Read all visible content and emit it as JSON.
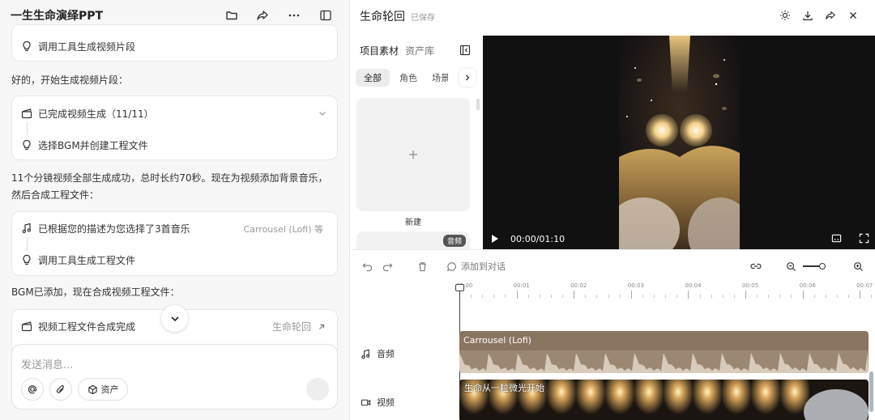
{
  "left": {
    "title": "一生生命演绎PPT",
    "step_tool_clip": "调用工具生成视频片段",
    "msg_start": "好的，开始生成视频片段：",
    "step_done": "已完成视频生成（11/11）",
    "step_bgm": "选择BGM并创建工程文件",
    "msg_summary_1": "11个分镜视频全部生成成功，总时长约70秒。现在为视频添加背景音乐，",
    "msg_summary_2": "然后合成工程文件：",
    "step_music": "已根据您的描述为您选择了3首音乐",
    "music_hint": "Carrousel (Lofi) 等",
    "step_tool_project": "调用工具生成工程文件",
    "msg_bgm": "BGM已添加，现在合成视频工程文件：",
    "step_project_done": "视频工程文件合成完成",
    "project_link": "生命轮回",
    "input_placeholder": "发送消息...",
    "assets_label": "资产"
  },
  "right": {
    "project_title": "生命轮回",
    "saved": "已保存",
    "tab_materials": "项目素材",
    "tab_library": "资产库",
    "chips": [
      "全部",
      "角色",
      "场景"
    ],
    "new_label": "新建",
    "audio_tag": "音频",
    "time": "00:00/01:10",
    "add_to_chat": "添加到对话",
    "ticks": [
      "00:00",
      "00:01",
      "00:02",
      "00:03",
      "00:04",
      "00:05",
      "00:06",
      "00:07"
    ],
    "audio_track_label": "音频",
    "video_track_label": "视频",
    "audio_clip": "Carrousel (Lofi)",
    "video_clip": "生命从一粒微光开始"
  },
  "colors": {
    "audio_track": "#8a7560",
    "accent": "#222222"
  }
}
